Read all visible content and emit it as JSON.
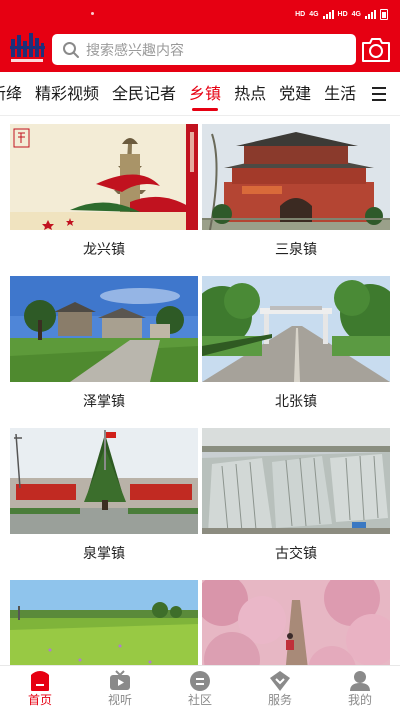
{
  "status_bar": {
    "sim1": "HD",
    "net1": "4G",
    "sim2": "HD",
    "net2": "4G"
  },
  "header": {
    "logo": "app-logo",
    "search_placeholder": "搜索感兴趣内容",
    "camera": "camera-icon",
    "accent_color": "#e60012"
  },
  "tabs": {
    "items": [
      "新绛",
      "精彩视频",
      "全民记者",
      "乡镇",
      "热点",
      "党建",
      "生活"
    ],
    "active_index": 3,
    "menu_icon": "menu-icon"
  },
  "towns": [
    {
      "name": "龙兴镇"
    },
    {
      "name": "三泉镇"
    },
    {
      "name": "泽掌镇"
    },
    {
      "name": "北张镇"
    },
    {
      "name": "泉掌镇"
    },
    {
      "name": "古交镇"
    },
    {
      "name": ""
    },
    {
      "name": ""
    }
  ],
  "bottom_nav": {
    "items": [
      {
        "label": "首页",
        "icon": "home-icon"
      },
      {
        "label": "视听",
        "icon": "tv-icon"
      },
      {
        "label": "社区",
        "icon": "community-icon"
      },
      {
        "label": "服务",
        "icon": "service-icon"
      },
      {
        "label": "我的",
        "icon": "profile-icon"
      }
    ],
    "active_index": 0
  }
}
